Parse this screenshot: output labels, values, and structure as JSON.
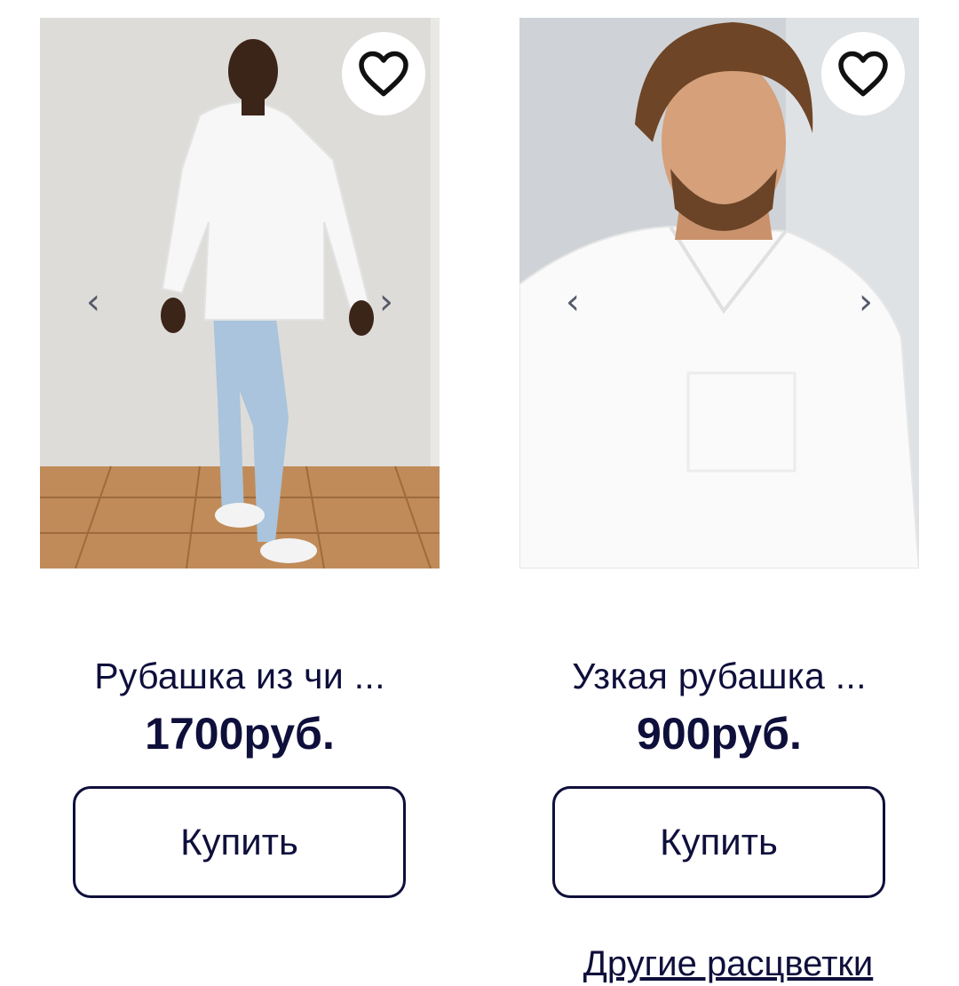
{
  "products": [
    {
      "name": "Рубашка из чи ...",
      "price": "1700руб.",
      "buy_label": "Купить",
      "prev_glyph": "‹",
      "next_glyph": "›",
      "favorite_icon": "heart-outline-icon"
    },
    {
      "name": "Узкая рубашка ...",
      "price": "900руб.",
      "buy_label": "Купить",
      "prev_glyph": "‹",
      "next_glyph": "›",
      "favorite_icon": "heart-outline-icon",
      "other_colors_label": "Другие расцветки"
    }
  ],
  "colors": {
    "text": "#0f0f3c",
    "arrow": "#555a6a",
    "background": "#ffffff"
  }
}
